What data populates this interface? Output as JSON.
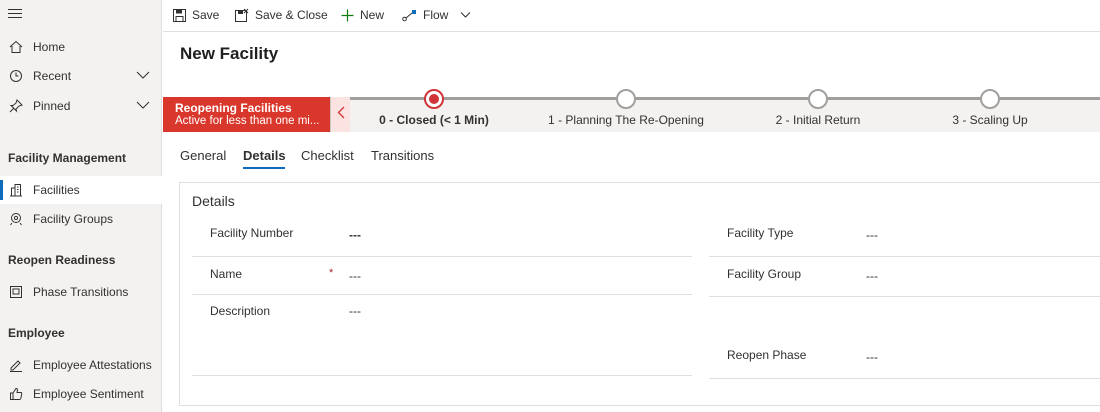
{
  "sidebar": {
    "nav": [
      {
        "label": "Home",
        "icon": "home-icon"
      },
      {
        "label": "Recent",
        "icon": "clock-icon"
      },
      {
        "label": "Pinned",
        "icon": "pin-icon"
      }
    ],
    "sections": [
      {
        "title": "Facility Management",
        "items": [
          {
            "label": "Facilities",
            "icon": "building-icon",
            "active": true
          },
          {
            "label": "Facility Groups",
            "icon": "map-pin-icon"
          }
        ]
      },
      {
        "title": "Reopen Readiness",
        "items": [
          {
            "label": "Phase Transitions",
            "icon": "document-icon"
          }
        ]
      },
      {
        "title": "Employee",
        "items": [
          {
            "label": "Employee Attestations",
            "icon": "pen-icon"
          },
          {
            "label": "Employee Sentiment",
            "icon": "thumbs-up-icon"
          }
        ]
      }
    ]
  },
  "toolbar": {
    "save_label": "Save",
    "save_close_label": "Save & Close",
    "new_label": "New",
    "flow_label": "Flow"
  },
  "page": {
    "title": "New Facility"
  },
  "bpf": {
    "process_name": "Reopening Facilities",
    "process_status": "Active for less than one mi...",
    "stages": [
      {
        "label": "0 - Closed  (< 1 Min)",
        "current": true
      },
      {
        "label": "1 - Planning The Re-Opening"
      },
      {
        "label": "2 - Initial Return"
      },
      {
        "label": "3 - Scaling Up"
      }
    ],
    "accent_color": "#d13438"
  },
  "tabs": [
    "General",
    "Details",
    "Checklist",
    "Transitions"
  ],
  "active_tab": "Details",
  "form": {
    "section_title": "Details",
    "left": [
      {
        "label": "Facility Number",
        "value": "---",
        "required": false
      },
      {
        "label": "Name",
        "value": "---",
        "required": true,
        "required_marker": "*"
      },
      {
        "label": "Description",
        "value": "---",
        "required": false
      }
    ],
    "right": [
      {
        "label": "Facility Type",
        "value": "---"
      },
      {
        "label": "Facility Group",
        "value": "---"
      },
      {
        "label": "Reopen Phase",
        "value": "---"
      }
    ]
  }
}
